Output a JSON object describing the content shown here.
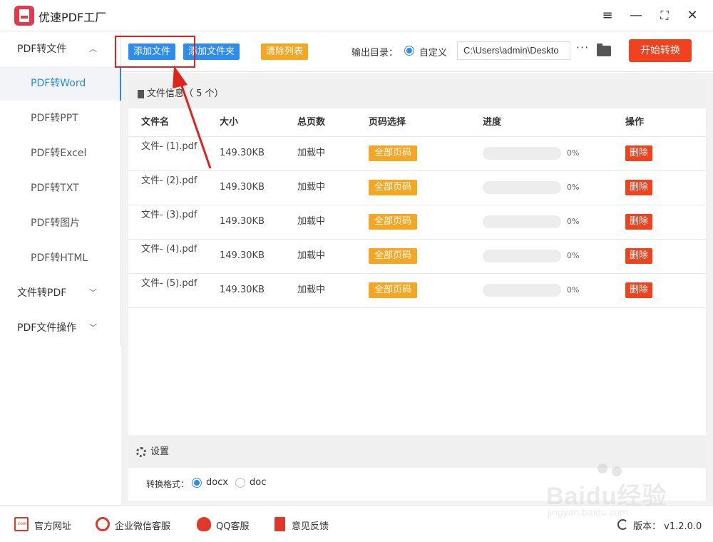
{
  "app": {
    "title": "优速PDF工厂"
  },
  "window": {
    "menu_icon": "menu-icon",
    "min_icon": "minimize-icon",
    "max_icon": "maximize-icon",
    "close_icon": "close-icon"
  },
  "sidebar": {
    "groups": [
      {
        "label": "PDF转文件",
        "expanded": true
      },
      {
        "label": "文件转PDF",
        "expanded": false
      },
      {
        "label": "PDF文件操作",
        "expanded": false
      }
    ],
    "items": [
      {
        "label": "PDF转Word",
        "active": true
      },
      {
        "label": "PDF转PPT",
        "active": false
      },
      {
        "label": "PDF转Excel",
        "active": false
      },
      {
        "label": "PDF转TXT",
        "active": false
      },
      {
        "label": "PDF转图片",
        "active": false
      },
      {
        "label": "PDF转HTML",
        "active": false
      }
    ]
  },
  "toolbar": {
    "add_file": "添加文件",
    "add_folder": "添加文件夹",
    "clear_list": "清除列表",
    "output_label": "输出目录：",
    "output_mode": "自定义",
    "output_path": "C:\\Users\\admin\\Deskto",
    "more": "···",
    "start": "开始转换"
  },
  "file_panel": {
    "title": "文件信息（ 5 个）",
    "columns": [
      "文件名",
      "大小",
      "总页数",
      "页码选择",
      "进度",
      "操作"
    ],
    "rows": [
      {
        "name": "文件- (1).pdf",
        "size": "149.30KB",
        "pages": "加载中",
        "page_select": "全部页码",
        "progress": 0,
        "progress_label": "0%",
        "action": "删除"
      },
      {
        "name": "文件- (2).pdf",
        "size": "149.30KB",
        "pages": "加载中",
        "page_select": "全部页码",
        "progress": 0,
        "progress_label": "0%",
        "action": "删除"
      },
      {
        "name": "文件- (3).pdf",
        "size": "149.30KB",
        "pages": "加载中",
        "page_select": "全部页码",
        "progress": 0,
        "progress_label": "0%",
        "action": "删除"
      },
      {
        "name": "文件- (4).pdf",
        "size": "149.30KB",
        "pages": "加载中",
        "page_select": "全部页码",
        "progress": 0,
        "progress_label": "0%",
        "action": "删除"
      },
      {
        "name": "文件- (5).pdf",
        "size": "149.30KB",
        "pages": "加载中",
        "page_select": "全部页码",
        "progress": 0,
        "progress_label": "0%",
        "action": "删除"
      }
    ]
  },
  "settings": {
    "title": "设置",
    "format_label": "转换格式：",
    "formats": [
      {
        "label": "docx",
        "selected": true
      },
      {
        "label": "doc",
        "selected": false
      }
    ]
  },
  "footer": {
    "links": [
      "官方网址",
      "企业微信客服",
      "QQ客服",
      "意见反馈"
    ],
    "version": "版本： v1.2.0.0"
  },
  "watermark": {
    "brand": "Baidu经验",
    "site": "jingyan.baidu.com"
  },
  "colors": {
    "accent": "#2d8cf0",
    "orange": "#f5a623",
    "danger": "#f0421e",
    "annotation": "#e0231c"
  }
}
